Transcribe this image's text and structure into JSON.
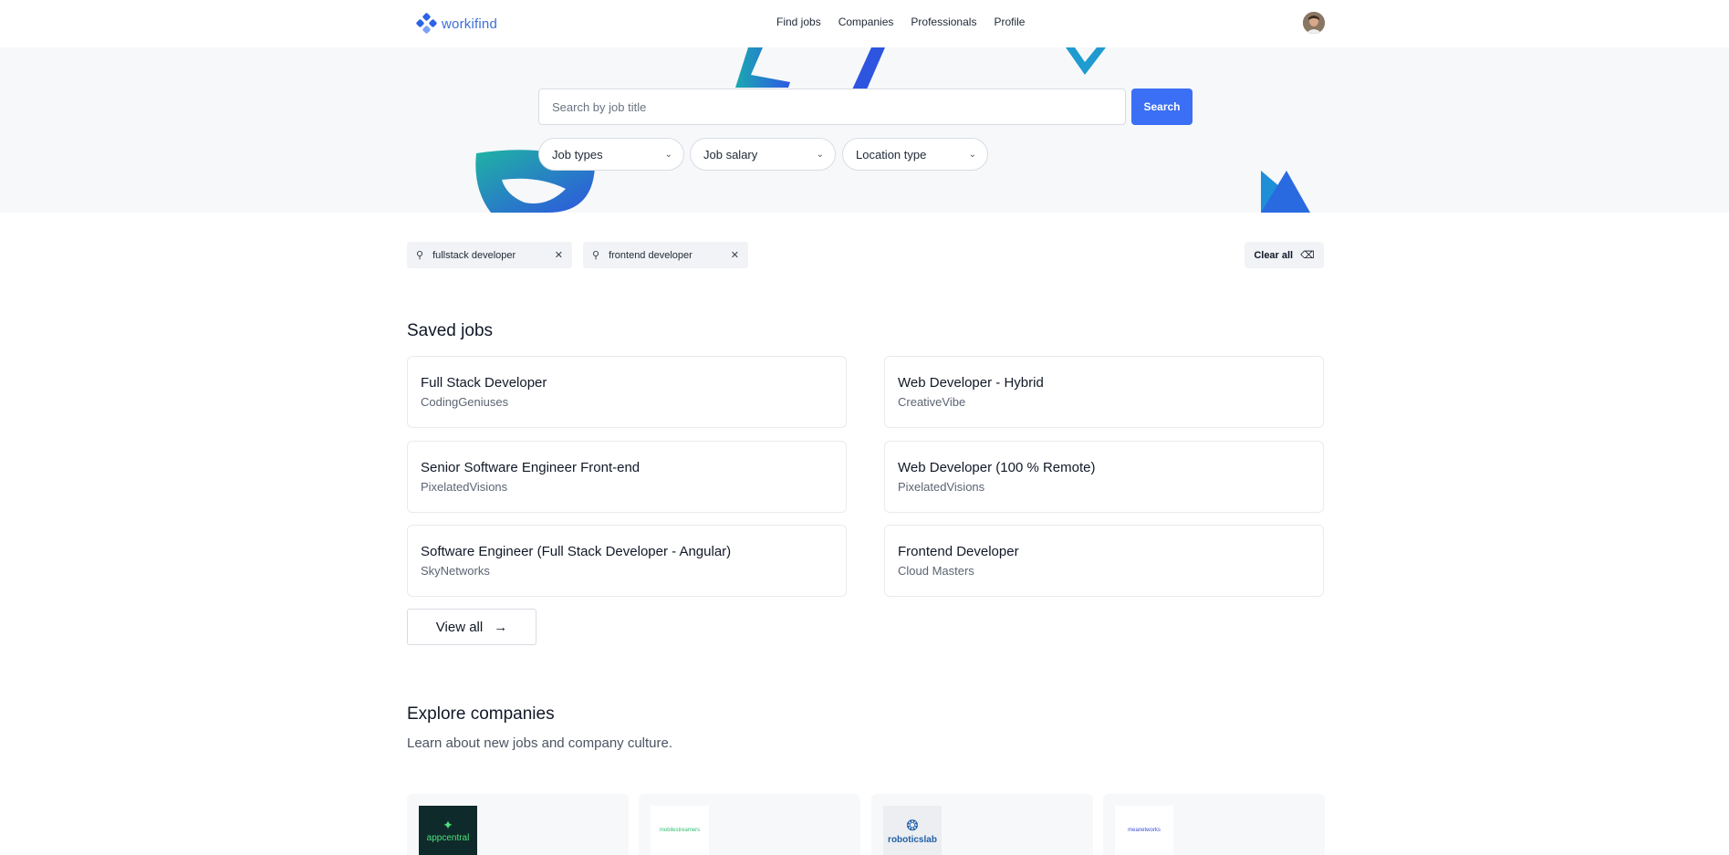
{
  "header": {
    "brand": "workifind",
    "nav": [
      {
        "label": "Find jobs"
      },
      {
        "label": "Companies"
      },
      {
        "label": "Professionals"
      },
      {
        "label": "Profile"
      }
    ]
  },
  "search": {
    "placeholder": "Search by job title",
    "button_label": "Search",
    "filters": [
      {
        "label": "Job types"
      },
      {
        "label": "Job salary"
      },
      {
        "label": "Location type"
      }
    ]
  },
  "active_searches": {
    "chips": [
      {
        "label": "fullstack developer"
      },
      {
        "label": "frontend developer"
      }
    ],
    "clear_all_label": "Clear all"
  },
  "saved_jobs": {
    "title": "Saved jobs",
    "jobs": [
      {
        "title": "Full Stack Developer",
        "company": "CodingGeniuses"
      },
      {
        "title": "Web Developer - Hybrid",
        "company": "CreativeVibe"
      },
      {
        "title": "Senior Software Engineer Front-end",
        "company": "PixelatedVisions"
      },
      {
        "title": "Web Developer (100 % Remote)",
        "company": "PixelatedVisions"
      },
      {
        "title": "Software Engineer (Full Stack Developer - Angular)",
        "company": "SkyNetworks"
      },
      {
        "title": "Frontend Developer",
        "company": "Cloud Masters"
      }
    ],
    "view_all_label": "View all"
  },
  "explore": {
    "title": "Explore companies",
    "subtitle": "Learn about new jobs and company culture.",
    "companies": [
      {
        "logo_text": "appcentral",
        "bg": "#0f2a2a",
        "fg": "#4ee07a"
      },
      {
        "logo_text": "mobilestreamers",
        "bg": "#ffffff",
        "fg": "#2fbf71"
      },
      {
        "logo_text": "roboticslab",
        "bg": "#eceef1",
        "fg": "#1f5fa8"
      },
      {
        "logo_text": "meanetworks",
        "bg": "#ffffff",
        "fg": "#3b4fd8"
      }
    ]
  },
  "colors": {
    "accent": "#3b6ff5",
    "hero_bg": "#f7f8fa"
  }
}
